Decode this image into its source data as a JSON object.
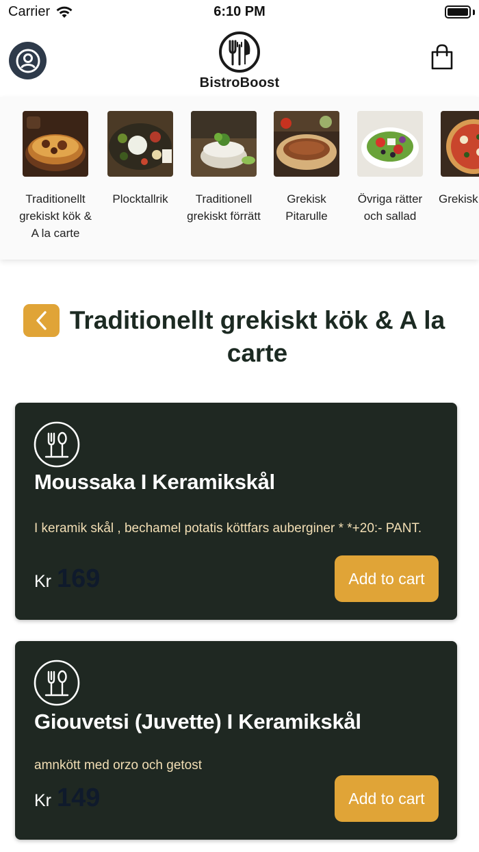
{
  "status_bar": {
    "carrier": "Carrier",
    "time": "6:10 PM"
  },
  "header": {
    "brand": "BistroBoost",
    "profile_icon": "user-icon",
    "cart_icon": "shopping-bag-icon"
  },
  "categories": [
    {
      "label": "Traditionellt grekiskt kök & A la carte"
    },
    {
      "label": "Plocktallrik"
    },
    {
      "label": "Traditionell grekiskt förrätt"
    },
    {
      "label": "Grekisk Pitarulle"
    },
    {
      "label": "Övriga rätter och sallad"
    },
    {
      "label": "Grekisk pizza"
    }
  ],
  "page": {
    "title": "Traditionellt grekiskt kök & A la carte",
    "back_icon": "chevron-left-icon"
  },
  "products": [
    {
      "name": "Moussaka I Keramikskål",
      "description": "I keramik skål , bechamel potatis köttfars auberginer * *+20:- PANT.",
      "currency": "Kr",
      "price": "169",
      "button": "Add to cart",
      "icon": "cutlery-icon"
    },
    {
      "name": "Giouvetsi (Juvette) I Keramikskål",
      "description": "amnkött med orzo och getost",
      "currency": "Kr",
      "price": "149",
      "button": "Add to cart",
      "icon": "cutlery-icon"
    }
  ],
  "colors": {
    "accent": "#e0a437",
    "card": "#1f2822",
    "title": "#1c2a22",
    "description": "#f3dfb5"
  }
}
